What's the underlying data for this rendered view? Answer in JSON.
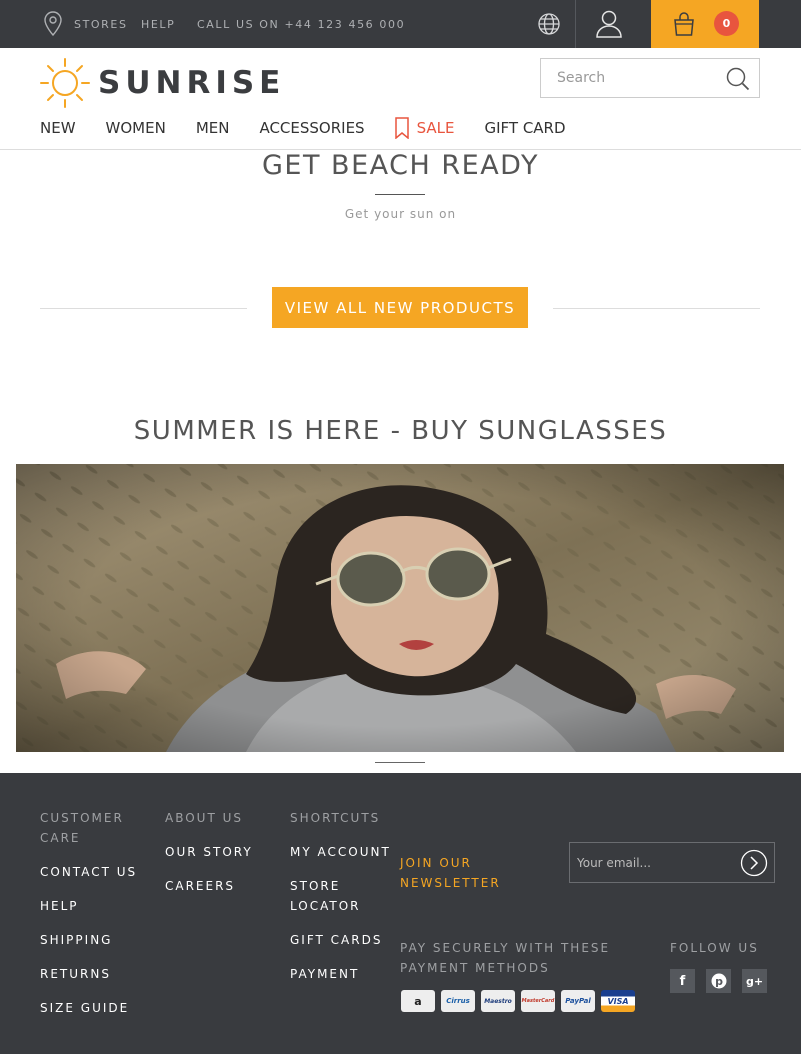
{
  "topbar": {
    "stores": "STORES",
    "help": "HELP",
    "call": "CALL US ON +44 123 456 000",
    "cart_count": "0"
  },
  "header": {
    "logo": "SUNRISE",
    "search_placeholder": "Search"
  },
  "nav": {
    "items": [
      "NEW",
      "WOMEN",
      "MEN",
      "ACCESSORIES",
      "SALE",
      "GIFT CARD"
    ]
  },
  "hero": {
    "title": "GET BEACH READY",
    "subtitle": "Get your sun on",
    "button": "VIEW ALL NEW PRODUCTS"
  },
  "promo": {
    "title": "SUMMER IS HERE - BUY SUNGLASSES"
  },
  "footer": {
    "col1": {
      "heading": "CUSTOMER CARE",
      "links": [
        "CONTACT US",
        "HELP",
        "SHIPPING",
        "RETURNS",
        "SIZE GUIDE"
      ]
    },
    "col2": {
      "heading": "ABOUT US",
      "links": [
        "OUR STORY",
        "CAREERS"
      ]
    },
    "col3": {
      "heading": "SHORTCUTS",
      "links": [
        "MY ACCOUNT",
        "STORE LOCATOR",
        "GIFT CARDS",
        "PAYMENT"
      ]
    },
    "newsletter": {
      "label": "JOIN OUR NEWSLETTER",
      "placeholder": "Your email..."
    },
    "payment": {
      "heading": "PAY SECURELY WITH THESE PAYMENT METHODS",
      "methods": [
        "a",
        "Cirrus",
        "Maestro",
        "MasterCard",
        "PayPal",
        "VISA"
      ]
    },
    "follow": {
      "heading": "FOLLOW US",
      "icons": [
        "facebook-icon",
        "pinterest-icon",
        "google-plus-icon"
      ]
    }
  },
  "colors": {
    "accent": "#f5a623",
    "sale": "#e8553e",
    "dark": "#393b3f"
  }
}
